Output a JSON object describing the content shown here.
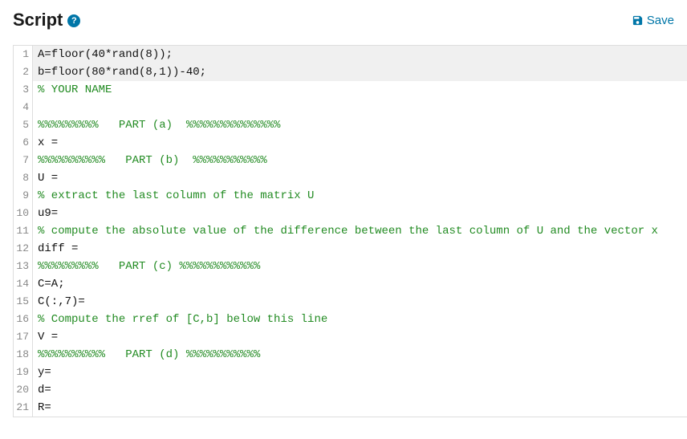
{
  "header": {
    "title": "Script",
    "help_glyph": "?",
    "save_label": "Save"
  },
  "editor": {
    "lines": [
      {
        "num": "1",
        "readonly": true,
        "segments": [
          {
            "cls": "plain",
            "text": "A=floor(40*rand(8));"
          }
        ]
      },
      {
        "num": "2",
        "readonly": true,
        "segments": [
          {
            "cls": "plain",
            "text": "b=floor(80*rand(8,1))-40;"
          }
        ]
      },
      {
        "num": "3",
        "readonly": false,
        "segments": [
          {
            "cls": "comment",
            "text": "% YOUR NAME"
          }
        ]
      },
      {
        "num": "4",
        "readonly": false,
        "segments": [
          {
            "cls": "plain",
            "text": ""
          }
        ]
      },
      {
        "num": "5",
        "readonly": false,
        "segments": [
          {
            "cls": "comment",
            "text": "%%%%%%%%%   PART (a)  %%%%%%%%%%%%%%"
          }
        ]
      },
      {
        "num": "6",
        "readonly": false,
        "segments": [
          {
            "cls": "plain",
            "text": "x = "
          }
        ]
      },
      {
        "num": "7",
        "readonly": false,
        "segments": [
          {
            "cls": "comment",
            "text": "%%%%%%%%%%   PART (b)  %%%%%%%%%%%"
          }
        ]
      },
      {
        "num": "8",
        "readonly": false,
        "segments": [
          {
            "cls": "plain",
            "text": "U = "
          }
        ]
      },
      {
        "num": "9",
        "readonly": false,
        "segments": [
          {
            "cls": "comment",
            "text": "% extract the last column of the matrix U"
          }
        ]
      },
      {
        "num": "10",
        "readonly": false,
        "segments": [
          {
            "cls": "plain",
            "text": "u9="
          }
        ]
      },
      {
        "num": "11",
        "readonly": false,
        "segments": [
          {
            "cls": "comment",
            "text": "% compute the absolute value of the difference between the last column of U and the vector x"
          }
        ]
      },
      {
        "num": "12",
        "readonly": false,
        "segments": [
          {
            "cls": "plain",
            "text": "diff = "
          }
        ]
      },
      {
        "num": "13",
        "readonly": false,
        "segments": [
          {
            "cls": "comment",
            "text": "%%%%%%%%%   PART (c) %%%%%%%%%%%%"
          }
        ]
      },
      {
        "num": "14",
        "readonly": false,
        "segments": [
          {
            "cls": "plain",
            "text": "C=A;"
          }
        ]
      },
      {
        "num": "15",
        "readonly": false,
        "segments": [
          {
            "cls": "plain",
            "text": "C(:,7)="
          }
        ]
      },
      {
        "num": "16",
        "readonly": false,
        "segments": [
          {
            "cls": "comment",
            "text": "% Compute the rref of [C,b] below this line"
          }
        ]
      },
      {
        "num": "17",
        "readonly": false,
        "segments": [
          {
            "cls": "plain",
            "text": "V ="
          }
        ]
      },
      {
        "num": "18",
        "readonly": false,
        "segments": [
          {
            "cls": "comment",
            "text": "%%%%%%%%%%   PART (d) %%%%%%%%%%%"
          }
        ]
      },
      {
        "num": "19",
        "readonly": false,
        "segments": [
          {
            "cls": "plain",
            "text": "y="
          }
        ]
      },
      {
        "num": "20",
        "readonly": false,
        "segments": [
          {
            "cls": "plain",
            "text": "d="
          }
        ]
      },
      {
        "num": "21",
        "readonly": false,
        "segments": [
          {
            "cls": "plain",
            "text": "R="
          }
        ]
      }
    ]
  }
}
